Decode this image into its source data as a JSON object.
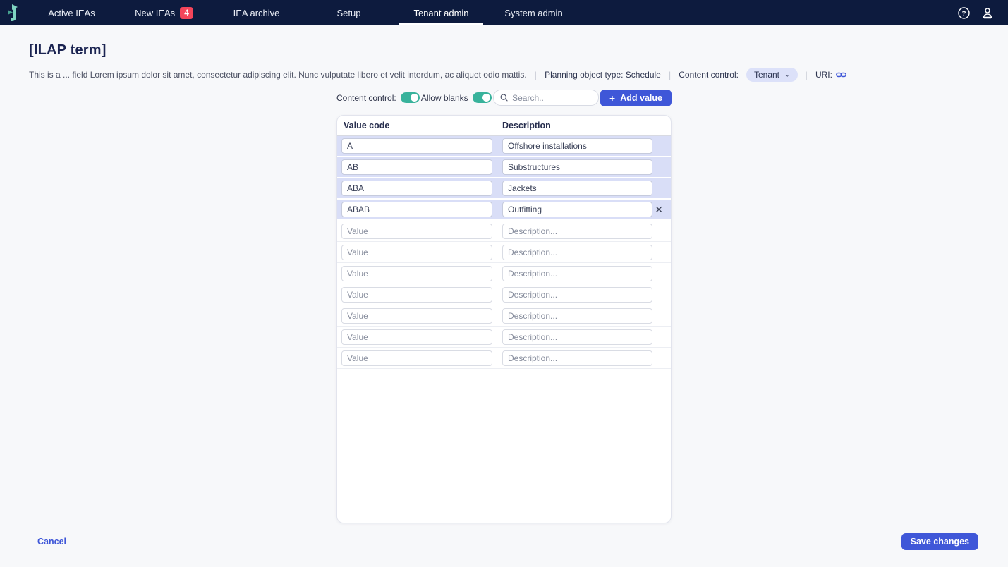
{
  "nav": {
    "tabs": [
      {
        "label": "Active IEAs"
      },
      {
        "label": "New IEAs",
        "badge": "4"
      },
      {
        "label": "IEA archive"
      },
      {
        "label": "Setup"
      },
      {
        "label": "Tenant admin",
        "active": true
      },
      {
        "label": "System admin"
      }
    ]
  },
  "header": {
    "title": "[ILAP term]",
    "description": "This is a ... field Lorem ipsum dolor sit amet, consectetur adipiscing elit. Nunc vulputate libero et velit interdum, ac aliquet odio mattis.",
    "planning_object_type": "Planning object type: Schedule",
    "content_control_label": "Content control:",
    "content_control_value": "Tenant",
    "uri_label": "URI:"
  },
  "toolbar": {
    "content_control_label": "Content control:",
    "content_control_on": true,
    "allow_blanks_label": "Allow blanks",
    "allow_blanks_on": true,
    "search_placeholder": "Search..",
    "add_value_label": "Add value"
  },
  "table": {
    "columns": [
      "Value code",
      "Description"
    ],
    "value_placeholder": "Value",
    "description_placeholder": "Description...",
    "rows": [
      {
        "code": "A",
        "description": "Offshore installations"
      },
      {
        "code": "AB",
        "description": "Substructures"
      },
      {
        "code": "ABA",
        "description": "Jackets"
      },
      {
        "code": "ABAB",
        "description": "Outfitting"
      }
    ],
    "empty_row_count": 7
  },
  "footer": {
    "cancel_label": "Cancel",
    "save_label": "Save changes"
  },
  "icons": {
    "plus": "+",
    "close": "✕",
    "chevron_down": "⌄",
    "help": "?"
  },
  "colors": {
    "nav_background": "#0d1b3e",
    "accent_blue": "#3f57d8",
    "toggle_green": "#38b29b",
    "badge_red": "#f4455a",
    "row_highlight": "#d9def7",
    "pill_background": "#dce1f9"
  }
}
